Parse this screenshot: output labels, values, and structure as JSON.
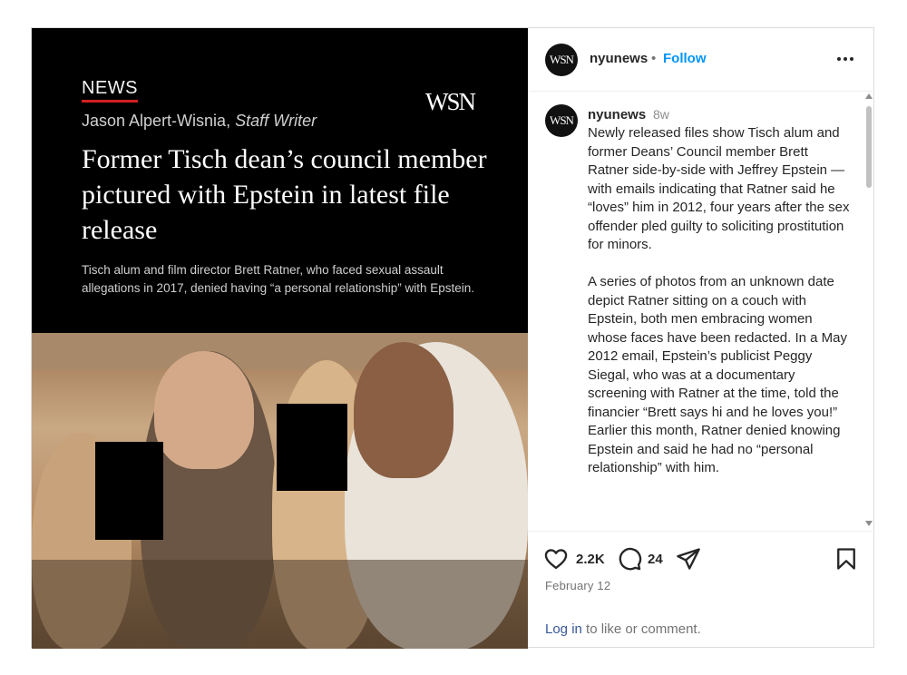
{
  "media": {
    "section_label": "NEWS",
    "byline_name": "Jason Alpert-Wisnia, ",
    "byline_role": "Staff Writer",
    "logo_text": "WSN",
    "headline": "Former Tisch dean’s council member pictured with Epstein in latest file release",
    "dek": "Tisch alum and film director Brett Ratner, who faced sexual assault allegations in 2017, denied having “a personal relationship” with Epstein."
  },
  "header": {
    "avatar_text": "WSN",
    "username": "nyunews",
    "separator": "•",
    "follow_label": "Follow"
  },
  "caption": {
    "avatar_text": "WSN",
    "username": "nyunews",
    "time_ago": "8w",
    "paragraph_1": "Newly released files show Tisch alum and former Deans’ Council member Brett Ratner side-by-side with Jeffrey Epstein — with emails indicating that Ratner said he “loves” him in 2012, four years after the sex offender pled guilty to soliciting prostitution for minors.",
    "paragraph_2": "A series of photos from an unknown date depict Ratner sitting on a couch with Epstein, both men embracing women whose faces have been redacted. In a May 2012 email, Epstein’s publicist Peggy Siegal, who was at a documentary screening with Ratner at the time, told the financier “Brett says hi and he loves you!” Earlier this month, Ratner denied knowing Epstein and said he had no “personal relationship” with him."
  },
  "actions": {
    "like_count": "2.2K",
    "comment_count": "24",
    "date": "February 12",
    "login_link": "Log in",
    "login_rest": " to like or comment."
  },
  "icons": [
    "heart-icon",
    "comment-icon",
    "share-icon",
    "bookmark-icon",
    "more-icon"
  ],
  "colors": {
    "follow": "#0095f6",
    "news_underline": "#d32020",
    "link": "#385898"
  }
}
